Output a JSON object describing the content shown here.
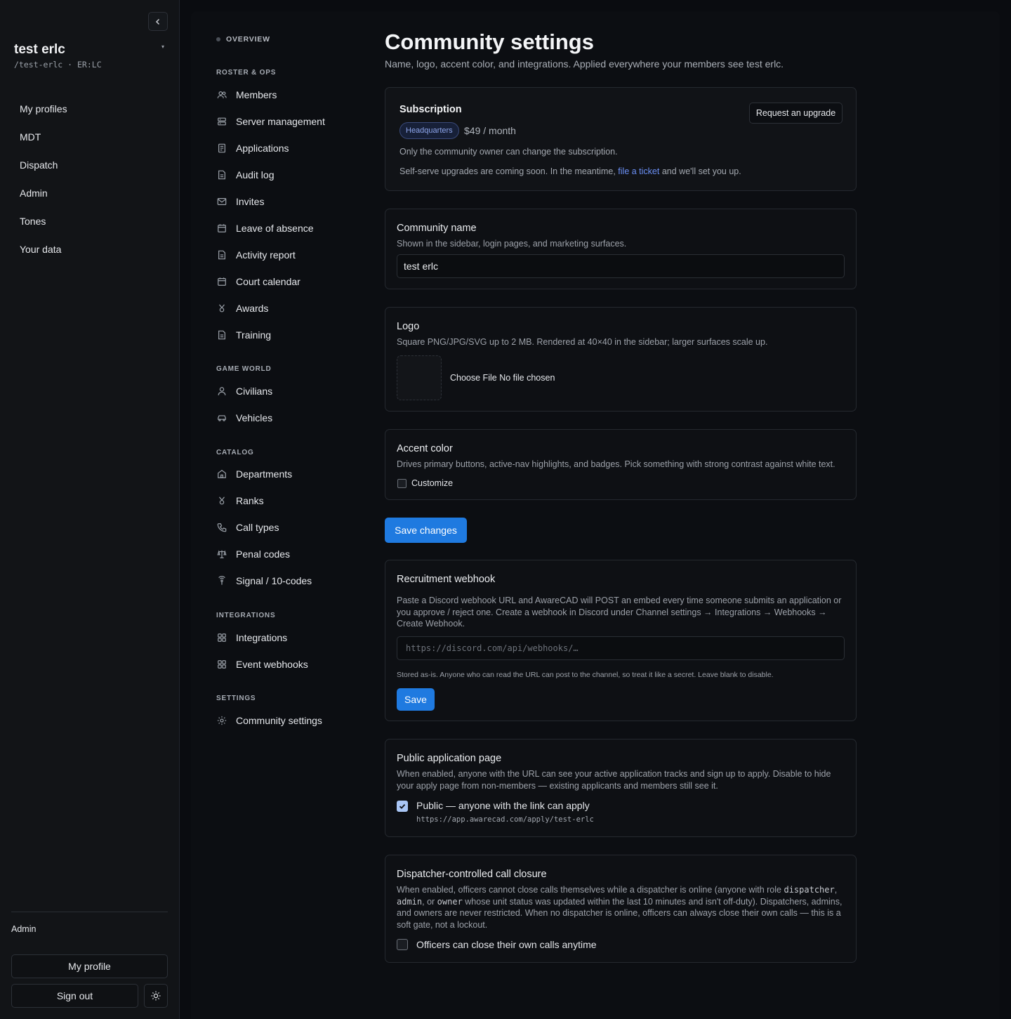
{
  "sidebar": {
    "community_name": "test erlc",
    "community_slug": "/test-erlc · ER:LC",
    "nav": [
      "My profiles",
      "MDT",
      "Dispatch",
      "Admin",
      "Tones",
      "Your data"
    ],
    "role": "Admin",
    "my_profile_label": "My profile",
    "sign_out_label": "Sign out",
    "icons": {
      "collapse": "chevron-left-icon",
      "caret": "caret-down-icon",
      "theme": "sun-icon"
    }
  },
  "settings_nav": {
    "overview": "OVERVIEW",
    "groups": [
      {
        "label": "ROSTER & OPS",
        "items": [
          {
            "label": "Members",
            "icon": "users-icon"
          },
          {
            "label": "Server management",
            "icon": "server-icon"
          },
          {
            "label": "Applications",
            "icon": "document-icon"
          },
          {
            "label": "Audit log",
            "icon": "document-icon"
          },
          {
            "label": "Invites",
            "icon": "mail-icon"
          },
          {
            "label": "Leave of absence",
            "icon": "calendar-icon"
          },
          {
            "label": "Activity report",
            "icon": "document-icon"
          },
          {
            "label": "Court calendar",
            "icon": "calendar-icon"
          },
          {
            "label": "Awards",
            "icon": "award-icon"
          },
          {
            "label": "Training",
            "icon": "document-icon"
          }
        ]
      },
      {
        "label": "GAME WORLD",
        "items": [
          {
            "label": "Civilians",
            "icon": "user-icon"
          },
          {
            "label": "Vehicles",
            "icon": "car-icon"
          }
        ]
      },
      {
        "label": "CATALOG",
        "items": [
          {
            "label": "Departments",
            "icon": "building-icon"
          },
          {
            "label": "Ranks",
            "icon": "award-icon"
          },
          {
            "label": "Call types",
            "icon": "phone-icon"
          },
          {
            "label": "Penal codes",
            "icon": "scale-icon"
          },
          {
            "label": "Signal / 10-codes",
            "icon": "signal-icon"
          }
        ]
      },
      {
        "label": "INTEGRATIONS",
        "items": [
          {
            "label": "Integrations",
            "icon": "grid-icon"
          },
          {
            "label": "Event webhooks",
            "icon": "grid-icon"
          }
        ]
      },
      {
        "label": "SETTINGS",
        "items": [
          {
            "label": "Community settings",
            "icon": "gear-icon"
          }
        ]
      }
    ]
  },
  "page": {
    "title": "Community settings",
    "subtitle": "Name, logo, accent color, and integrations. Applied everywhere your members see test erlc."
  },
  "subscription": {
    "title": "Subscription",
    "plan": "Headquarters",
    "price": "$49 / month",
    "owner_note": "Only the community owner can change the subscription.",
    "upgrade_note_before": "Self-serve upgrades are coming soon. In the meantime,",
    "upgrade_link": "file a ticket",
    "upgrade_note_after": "and we'll set you up.",
    "upgrade_button": "Request an upgrade"
  },
  "community_name": {
    "title": "Community name",
    "desc": "Shown in the sidebar, login pages, and marketing surfaces.",
    "value": "test erlc"
  },
  "logo": {
    "title": "Logo",
    "desc": "Square PNG/JPG/SVG up to 2 MB. Rendered at 40×40 in the sidebar; larger surfaces scale up.",
    "file_button": "Choose File",
    "file_status": "No file chosen"
  },
  "accent": {
    "title": "Accent color",
    "desc": "Drives primary buttons, active-nav highlights, and badges. Pick something with strong contrast against white text.",
    "customize_label": "Customize",
    "customize_checked": false
  },
  "save_changes_label": "Save changes",
  "webhook": {
    "title": "Recruitment webhook",
    "desc": "Paste a Discord webhook URL and AwareCAD will POST an embed every time someone submits an application or you approve / reject one. Create a webhook in Discord under Channel settings → Integrations → Webhooks → Create Webhook.",
    "placeholder": "https://discord.com/api/webhooks/…",
    "value": "",
    "note": "Stored as-is. Anyone who can read the URL can post to the channel, so treat it like a secret. Leave blank to disable.",
    "save_label": "Save"
  },
  "public_apply": {
    "title": "Public application page",
    "desc": "When enabled, anyone with the URL can see your active application tracks and sign up to apply. Disable to hide your apply page from non-members — existing applicants and members still see it.",
    "checkbox_label": "Public — anyone with the link can apply",
    "checked": true,
    "url": "https://app.awarecad.com/apply/test-erlc"
  },
  "call_closure": {
    "title": "Dispatcher-controlled call closure",
    "desc_1": "When enabled, officers cannot close calls themselves while a dispatcher is online (anyone with role",
    "role_dispatcher": "dispatcher",
    "sep_1": ",",
    "role_admin": "admin",
    "sep_2": ", or",
    "role_owner": "owner",
    "desc_2": "whose unit status was updated within the last 10 minutes and isn't off-duty). Dispatchers, admins, and owners are never restricted. When no dispatcher is online, officers can always close their own calls — this is a soft gate, not a lockout.",
    "checkbox_label": "Officers can close their own calls anytime",
    "checked": false
  },
  "colors": {
    "primary": "#1f7ae0",
    "link": "#6b8ff5",
    "badge_bg": "#172038"
  }
}
